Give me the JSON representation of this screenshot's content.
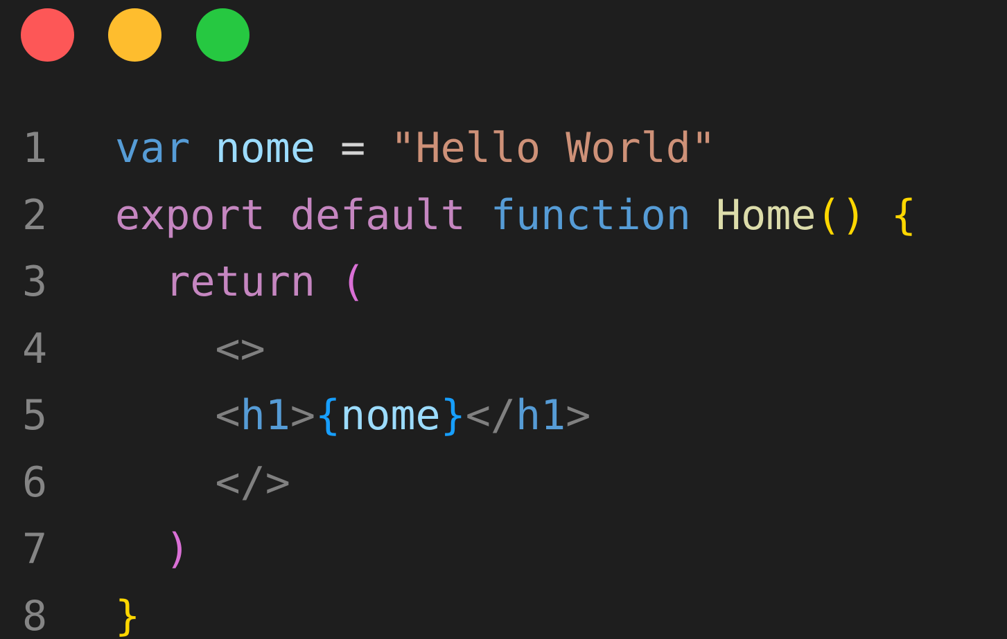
{
  "window": {
    "traffic_lights": [
      {
        "name": "close",
        "color": "#fd5757"
      },
      {
        "name": "minimize",
        "color": "#febd2e"
      },
      {
        "name": "maximize",
        "color": "#26c841"
      }
    ]
  },
  "colors": {
    "background": "#1e1e1e",
    "line_number": "#858585",
    "keyword_blue": "#569cd6",
    "keyword_purple": "#c586c0",
    "variable": "#9cdcfe",
    "string": "#ce9178",
    "function_name": "#dcdcaa",
    "punctuation": "#d4d4d4",
    "bracket_gold": "#ffd700",
    "bracket_pink": "#da70d6",
    "bracket_blue": "#179fff",
    "tag_punct": "#808080",
    "tag_name": "#569cd6"
  },
  "code": {
    "lines": [
      {
        "number": "1",
        "tokens": [
          {
            "text": "var",
            "color": "#569cd6"
          },
          {
            "text": " ",
            "color": "#d4d4d4"
          },
          {
            "text": "nome",
            "color": "#9cdcfe"
          },
          {
            "text": " = ",
            "color": "#d4d4d4"
          },
          {
            "text": "\"Hello World\"",
            "color": "#ce9178"
          }
        ]
      },
      {
        "number": "2",
        "tokens": [
          {
            "text": "export",
            "color": "#c586c0"
          },
          {
            "text": " ",
            "color": "#d4d4d4"
          },
          {
            "text": "default",
            "color": "#c586c0"
          },
          {
            "text": " ",
            "color": "#d4d4d4"
          },
          {
            "text": "function",
            "color": "#569cd6"
          },
          {
            "text": " ",
            "color": "#d4d4d4"
          },
          {
            "text": "Home",
            "color": "#dcdcaa"
          },
          {
            "text": "()",
            "color": "#ffd700"
          },
          {
            "text": " ",
            "color": "#d4d4d4"
          },
          {
            "text": "{",
            "color": "#ffd700"
          }
        ]
      },
      {
        "number": "3",
        "tokens": [
          {
            "text": "  ",
            "color": "#d4d4d4"
          },
          {
            "text": "return",
            "color": "#c586c0"
          },
          {
            "text": " ",
            "color": "#d4d4d4"
          },
          {
            "text": "(",
            "color": "#da70d6"
          }
        ]
      },
      {
        "number": "4",
        "tokens": [
          {
            "text": "    ",
            "color": "#d4d4d4"
          },
          {
            "text": "<>",
            "color": "#808080"
          }
        ]
      },
      {
        "number": "5",
        "tokens": [
          {
            "text": "    ",
            "color": "#d4d4d4"
          },
          {
            "text": "<",
            "color": "#808080"
          },
          {
            "text": "h1",
            "color": "#569cd6"
          },
          {
            "text": ">",
            "color": "#808080"
          },
          {
            "text": "{",
            "color": "#179fff"
          },
          {
            "text": "nome",
            "color": "#9cdcfe"
          },
          {
            "text": "}",
            "color": "#179fff"
          },
          {
            "text": "</",
            "color": "#808080"
          },
          {
            "text": "h1",
            "color": "#569cd6"
          },
          {
            "text": ">",
            "color": "#808080"
          }
        ]
      },
      {
        "number": "6",
        "tokens": [
          {
            "text": "    ",
            "color": "#d4d4d4"
          },
          {
            "text": "</>",
            "color": "#808080"
          }
        ]
      },
      {
        "number": "7",
        "tokens": [
          {
            "text": "  ",
            "color": "#d4d4d4"
          },
          {
            "text": ")",
            "color": "#da70d6"
          }
        ]
      },
      {
        "number": "8",
        "tokens": [
          {
            "text": "}",
            "color": "#ffd700"
          }
        ]
      }
    ]
  }
}
